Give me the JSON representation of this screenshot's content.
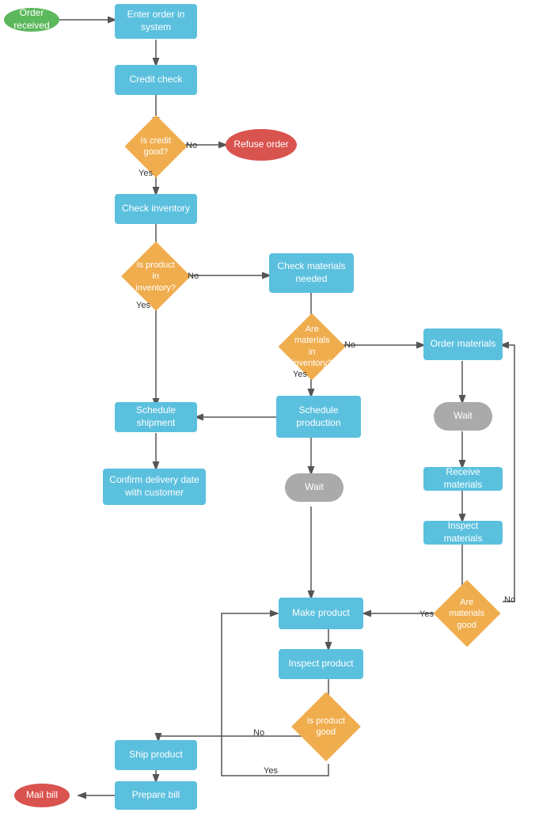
{
  "nodes": {
    "order_received": {
      "label": "Order received"
    },
    "enter_order": {
      "label": "Enter order in system"
    },
    "credit_check": {
      "label": "Credit check"
    },
    "is_credit_good": {
      "label": "Is credit good?"
    },
    "refuse_order": {
      "label": "Refuse order"
    },
    "check_inventory": {
      "label": "Check inventory"
    },
    "is_product_in_inventory": {
      "label": "Is product in inventory?"
    },
    "check_materials_needed": {
      "label": "Check materials needed"
    },
    "are_materials_in_inventory": {
      "label": "Are materials in inventory?"
    },
    "order_materials": {
      "label": "Order materials"
    },
    "wait1": {
      "label": "Wait"
    },
    "receive_materials": {
      "label": "Receive materials"
    },
    "inspect_materials": {
      "label": "Inspect materials"
    },
    "are_materials_good": {
      "label": "Are materials good"
    },
    "schedule_production": {
      "label": "Schedule production"
    },
    "wait2": {
      "label": "Wait"
    },
    "schedule_shipment": {
      "label": "Schedule shipment"
    },
    "confirm_delivery": {
      "label": "Confirm delivery date with customer"
    },
    "make_product": {
      "label": "Make product"
    },
    "inspect_product": {
      "label": "Inspect product"
    },
    "is_product_good": {
      "label": "Is product good"
    },
    "ship_product": {
      "label": "Ship product"
    },
    "prepare_bill": {
      "label": "Prepare bill"
    },
    "mail_bill": {
      "label": "Mail bill"
    }
  },
  "labels": {
    "no": "No",
    "yes": "Yes"
  }
}
